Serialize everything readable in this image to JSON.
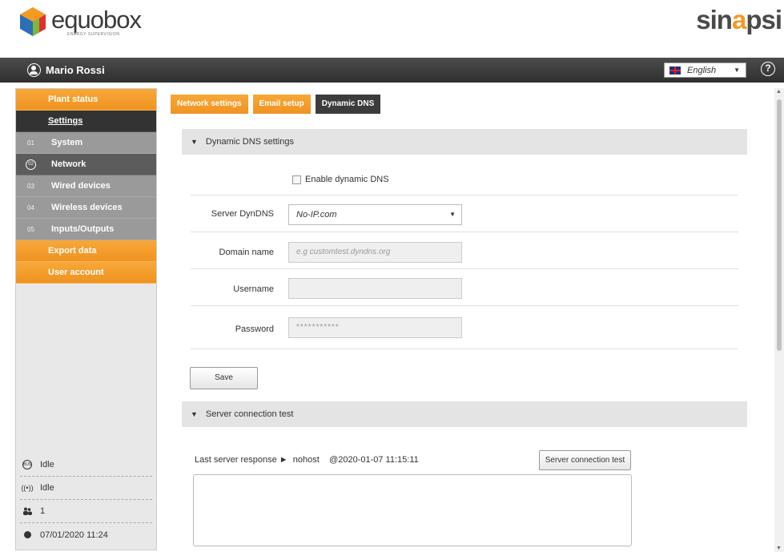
{
  "header": {
    "logo_name": "equobox",
    "logo_tagline": "ENERGY SUPERVISION",
    "brand_right_a": "sin",
    "brand_right_b": "a",
    "brand_right_c": "psi"
  },
  "userbar": {
    "user_name": "Mario Rossi",
    "language": "English",
    "help_symbol": "?"
  },
  "sidebar": {
    "items": [
      {
        "label": "Plant status",
        "style": "orange"
      },
      {
        "label": "Settings",
        "style": "dark"
      },
      {
        "num": "01",
        "label": "System",
        "style": "grey"
      },
      {
        "num": "02",
        "label": "Network",
        "style": "active"
      },
      {
        "num": "03",
        "label": "Wired devices",
        "style": "grey"
      },
      {
        "num": "04",
        "label": "Wireless devices",
        "style": "grey"
      },
      {
        "num": "05",
        "label": "Inputs/Outputs",
        "style": "grey"
      },
      {
        "label": "Export data",
        "style": "orange"
      },
      {
        "label": "User account",
        "style": "orange"
      }
    ],
    "status": [
      {
        "icon": "bus-icon",
        "text": "Idle"
      },
      {
        "icon": "wireless-icon",
        "text": "Idle"
      },
      {
        "icon": "users-icon",
        "text": "1"
      },
      {
        "icon": "clock-icon",
        "text": "07/01/2020 11:24"
      }
    ]
  },
  "tabs": [
    "Network settings",
    "Email setup",
    "Dynamic DNS"
  ],
  "ddns": {
    "section_title": "Dynamic DNS settings",
    "enable_label": "Enable dynamic DNS",
    "server_label": "Server DynDNS",
    "server_value": "No-IP.com",
    "domain_label": "Domain name",
    "domain_placeholder": "e.g customtest.dyndns.org",
    "username_label": "Username",
    "username_value": "",
    "password_label": "Password",
    "password_value": "***********",
    "save_label": "Save"
  },
  "conn_test": {
    "section_title": "Server connection test",
    "response_label": "Last server response ►",
    "response_value": "nohost",
    "response_time": "@2020-01-07 11:15:11",
    "button_label": "Server connection test"
  },
  "colors": {
    "accent": "#f39a23",
    "dark_bar": "#333333",
    "sidebar_grey": "#9a9a9a"
  }
}
